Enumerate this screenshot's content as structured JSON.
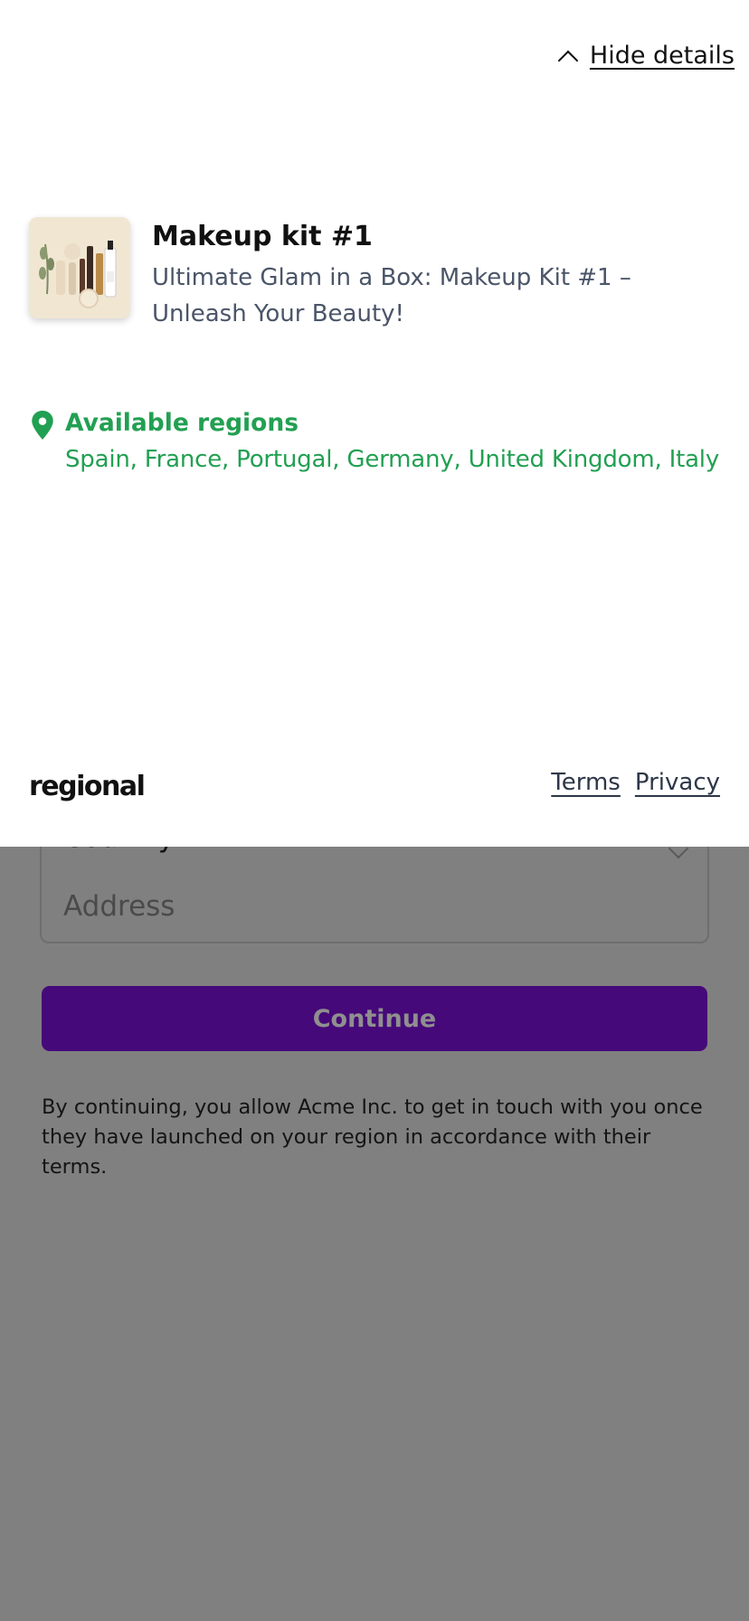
{
  "form": {
    "country_label": "Country",
    "address_placeholder": "Address",
    "continue_label": "Continue",
    "consent_text": "By continuing, you allow Acme Inc. to get in touch with you once they have launched on your region in accordance with their terms."
  },
  "details": {
    "hide_label": "Hide details",
    "product": {
      "title": "Makeup kit #1",
      "description": "Ultimate Glam in a Box: Makeup Kit #1 – Unleash Your Beauty!"
    },
    "regions": {
      "title": "Available regions",
      "list": "Spain, France, Portugal, Germany, United Kingdom, Italy"
    }
  },
  "footer": {
    "brand": "regional",
    "terms_label": "Terms",
    "privacy_label": "Privacy"
  },
  "colors": {
    "accent_green": "#22a052",
    "button_purple": "#46097a",
    "overlay": "#808080"
  }
}
